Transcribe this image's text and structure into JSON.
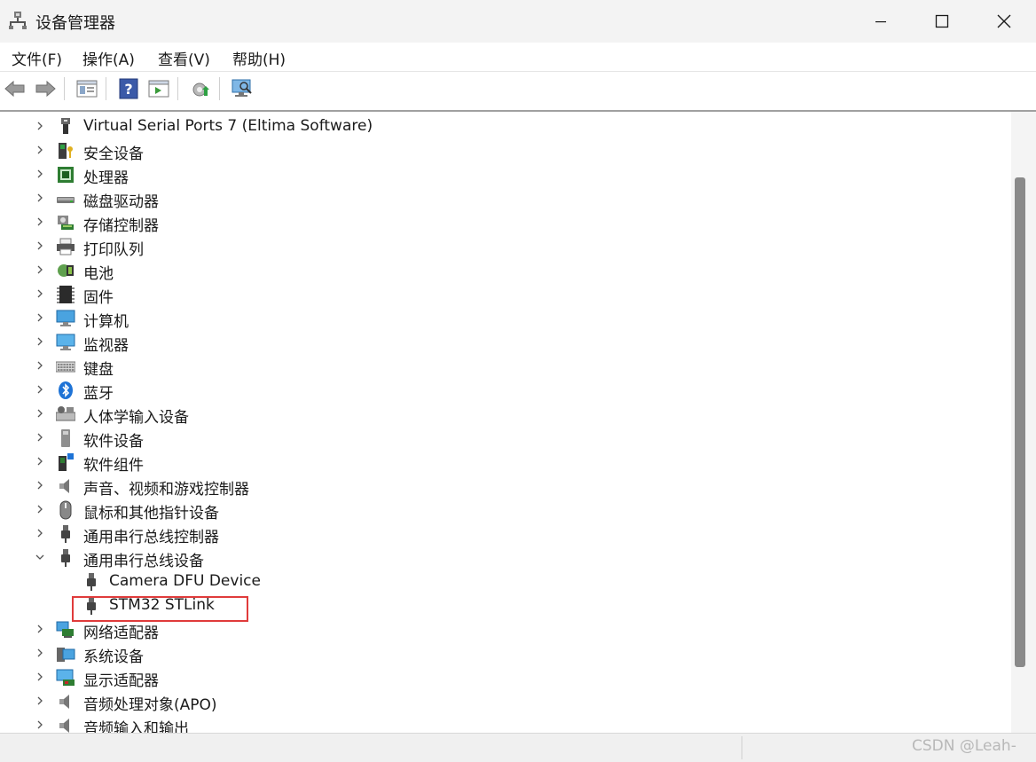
{
  "window": {
    "title": "设备管理器",
    "controls": [
      "minimize-icon",
      "maximize-icon",
      "close-icon"
    ]
  },
  "menu": [
    "文件(F)",
    "操作(A)",
    "查看(V)",
    "帮助(H)"
  ],
  "toolbar": [
    "back-arrow-icon",
    "forward-arrow-icon",
    "properties-icon",
    "help-icon",
    "run-icon",
    "update-driver-icon",
    "scan-hardware-icon"
  ],
  "tree": {
    "rows": [
      {
        "label": "Virtual Serial Ports 7 (Eltima Software)",
        "icon": "serial-port-icon",
        "state": "collapsed"
      },
      {
        "label": "安全设备",
        "icon": "security-device-icon",
        "state": "collapsed"
      },
      {
        "label": "处理器",
        "icon": "processor-icon",
        "state": "collapsed"
      },
      {
        "label": "磁盘驱动器",
        "icon": "disk-drive-icon",
        "state": "collapsed"
      },
      {
        "label": "存储控制器",
        "icon": "storage-controller-icon",
        "state": "collapsed"
      },
      {
        "label": "打印队列",
        "icon": "printer-icon",
        "state": "collapsed"
      },
      {
        "label": "电池",
        "icon": "battery-icon",
        "state": "collapsed"
      },
      {
        "label": "固件",
        "icon": "firmware-icon",
        "state": "collapsed"
      },
      {
        "label": "计算机",
        "icon": "computer-icon",
        "state": "collapsed"
      },
      {
        "label": "监视器",
        "icon": "monitor-icon",
        "state": "collapsed"
      },
      {
        "label": "键盘",
        "icon": "keyboard-icon",
        "state": "collapsed"
      },
      {
        "label": "蓝牙",
        "icon": "bluetooth-icon",
        "state": "collapsed"
      },
      {
        "label": "人体学输入设备",
        "icon": "hid-icon",
        "state": "collapsed"
      },
      {
        "label": "软件设备",
        "icon": "software-device-icon",
        "state": "collapsed"
      },
      {
        "label": "软件组件",
        "icon": "software-component-icon",
        "state": "collapsed"
      },
      {
        "label": "声音、视频和游戏控制器",
        "icon": "speaker-icon",
        "state": "collapsed"
      },
      {
        "label": "鼠标和其他指针设备",
        "icon": "mouse-icon",
        "state": "collapsed"
      },
      {
        "label": "通用串行总线控制器",
        "icon": "usb-icon",
        "state": "collapsed"
      },
      {
        "label": "通用串行总线设备",
        "icon": "usb-icon",
        "state": "expanded"
      },
      {
        "label": "Camera DFU Device",
        "icon": "usb-icon",
        "state": "child"
      },
      {
        "label": "STM32 STLink",
        "icon": "usb-icon",
        "state": "child"
      },
      {
        "label": "网络适配器",
        "icon": "network-adapter-icon",
        "state": "collapsed"
      },
      {
        "label": "系统设备",
        "icon": "system-device-icon",
        "state": "collapsed"
      },
      {
        "label": "显示适配器",
        "icon": "display-adapter-icon",
        "state": "collapsed"
      },
      {
        "label": "音频处理对象(APO)",
        "icon": "speaker-icon",
        "state": "collapsed"
      },
      {
        "label": "音频输入和输出",
        "icon": "speaker-icon",
        "state": "collapsed"
      }
    ]
  },
  "status": {
    "watermark": "CSDN @Leah-"
  },
  "colors": {
    "highlight_border": "#e03b3b",
    "title_bg": "#f3f3f3"
  }
}
